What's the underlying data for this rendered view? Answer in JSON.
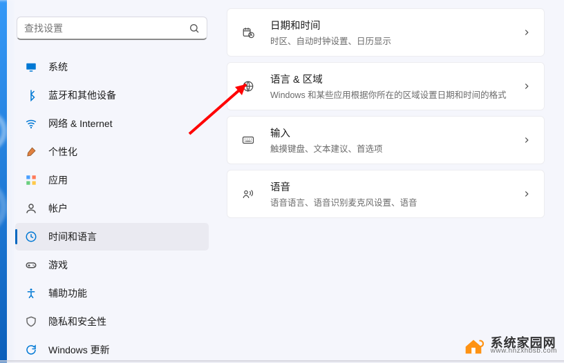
{
  "search": {
    "placeholder": "查找设置"
  },
  "nav": [
    {
      "key": "system",
      "label": "系统",
      "icon": "system"
    },
    {
      "key": "bluetooth",
      "label": "蓝牙和其他设备",
      "icon": "bluetooth"
    },
    {
      "key": "network",
      "label": "网络 & Internet",
      "icon": "wifi"
    },
    {
      "key": "personalization",
      "label": "个性化",
      "icon": "brush"
    },
    {
      "key": "apps",
      "label": "应用",
      "icon": "apps"
    },
    {
      "key": "accounts",
      "label": "帐户",
      "icon": "account"
    },
    {
      "key": "time",
      "label": "时间和语言",
      "icon": "clock",
      "active": true
    },
    {
      "key": "gaming",
      "label": "游戏",
      "icon": "gamepad"
    },
    {
      "key": "accessibility",
      "label": "辅助功能",
      "icon": "accessibility"
    },
    {
      "key": "privacy",
      "label": "隐私和安全性",
      "icon": "shield"
    },
    {
      "key": "update",
      "label": "Windows 更新",
      "icon": "update"
    }
  ],
  "cards": [
    {
      "key": "datetime",
      "icon": "calendar-clock",
      "title": "日期和时间",
      "sub": "时区、自动时钟设置、日历显示"
    },
    {
      "key": "language-region",
      "icon": "globe-lang",
      "title": "语言 & 区域",
      "sub": "Windows 和某些应用根据你所在的区域设置日期和时间的格式"
    },
    {
      "key": "typing",
      "icon": "keyboard",
      "title": "输入",
      "sub": "触摸键盘、文本建议、首选项"
    },
    {
      "key": "speech",
      "icon": "speech",
      "title": "语音",
      "sub": "语音语言、语音识别麦克风设置、语音"
    }
  ],
  "watermark": {
    "brand": "系统家园网",
    "url": "www.hnzxhbsb.com"
  }
}
